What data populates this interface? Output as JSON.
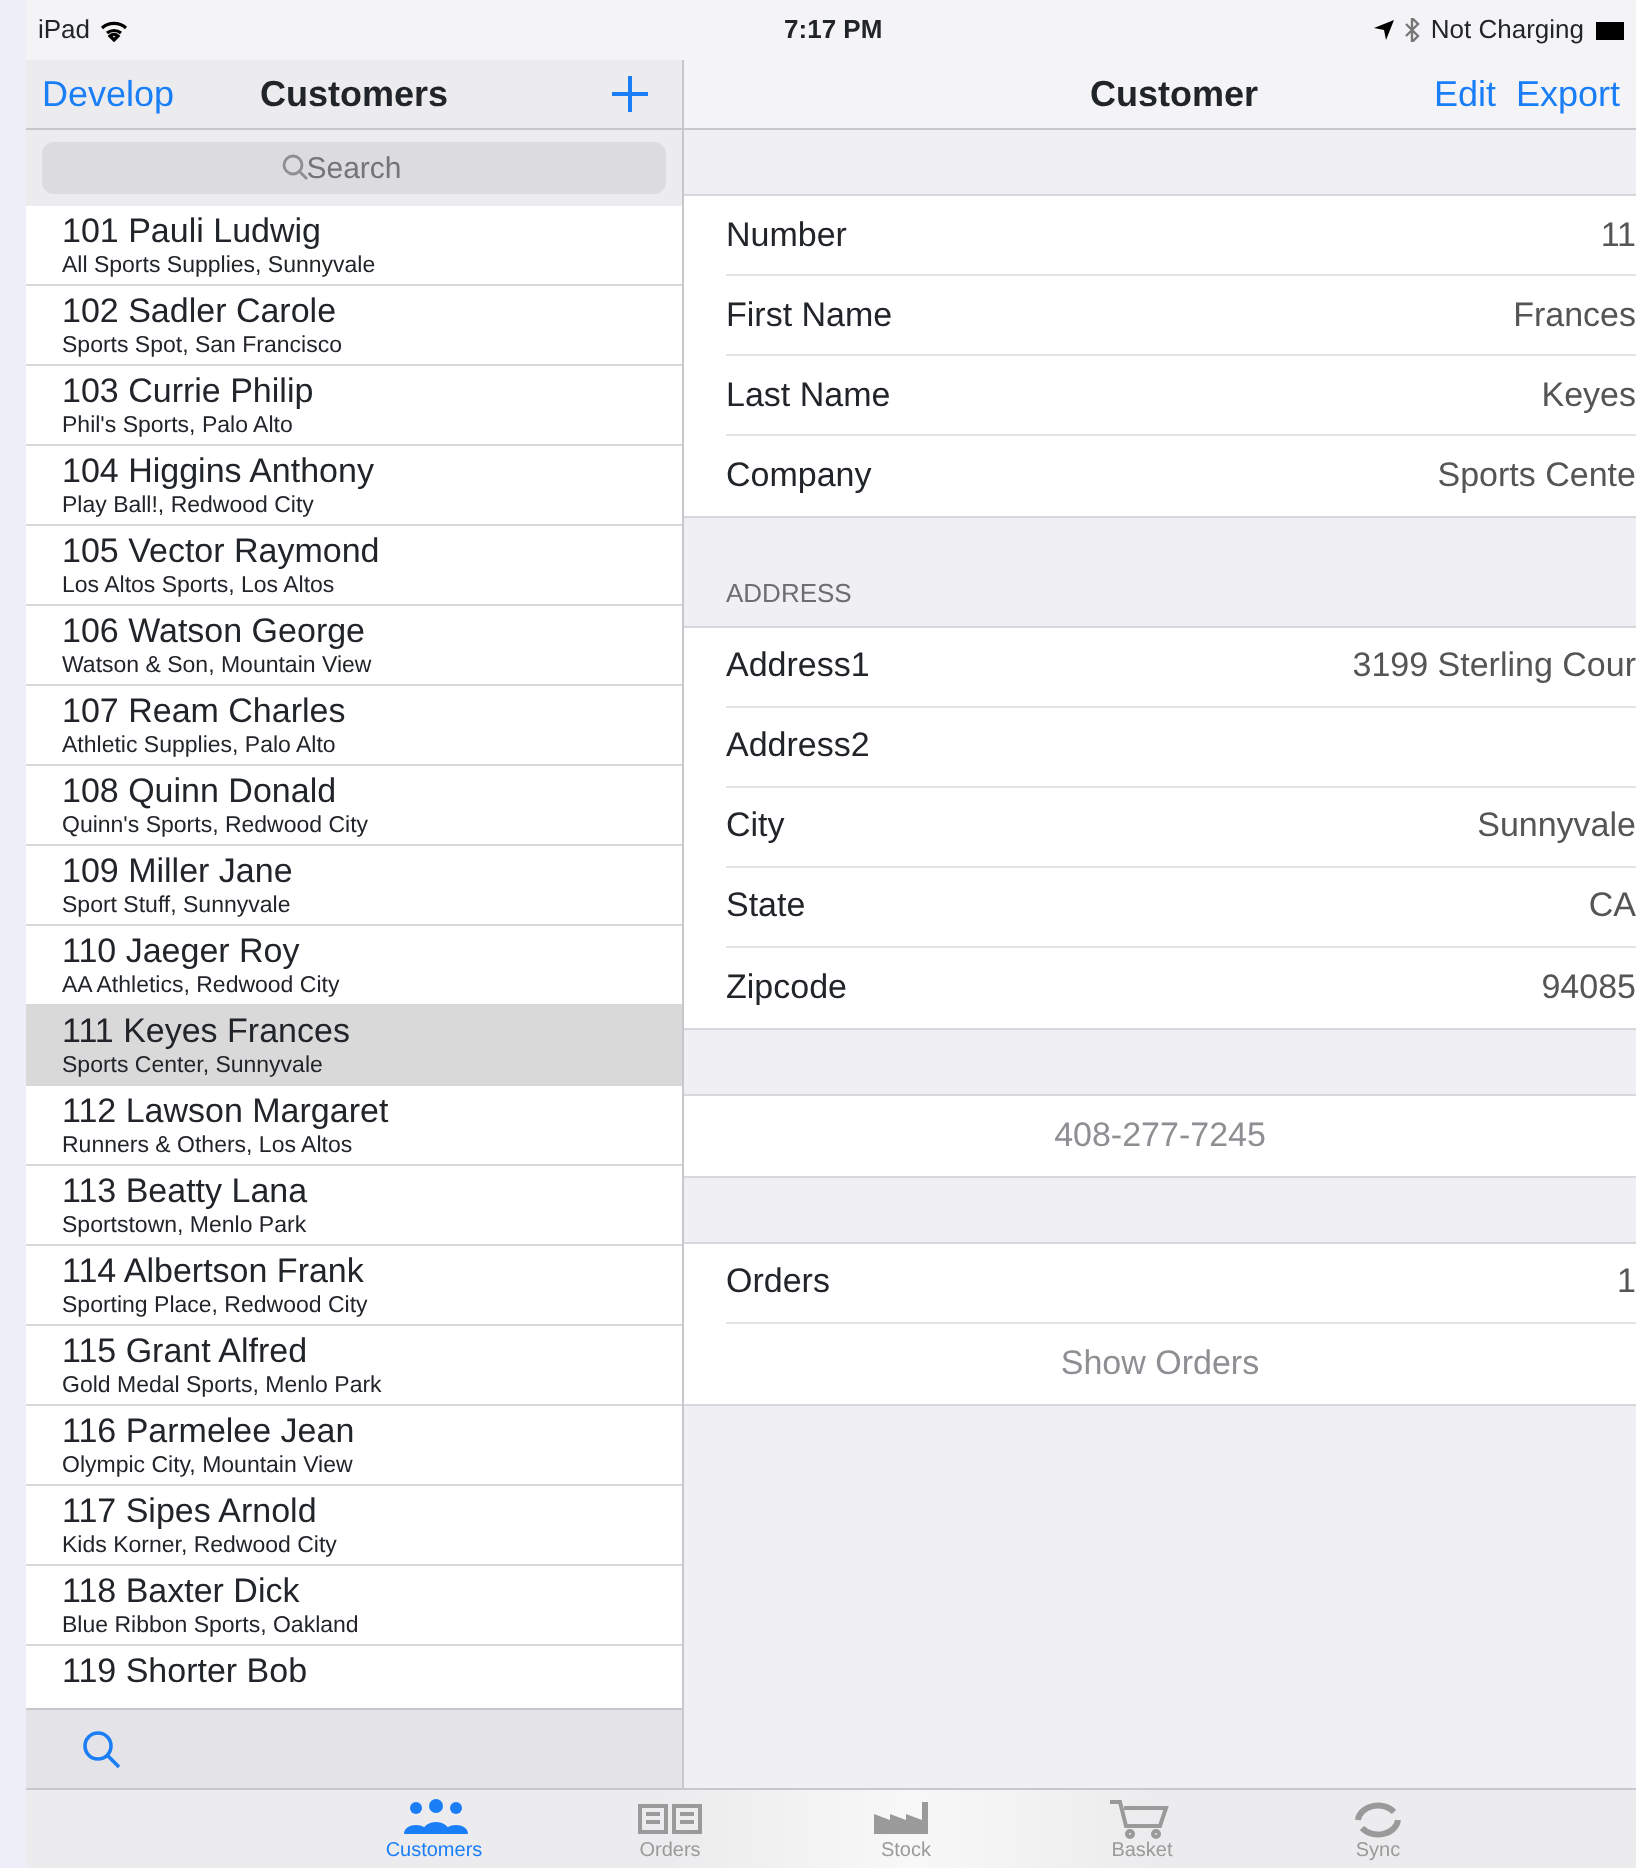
{
  "status_bar": {
    "device": "iPad",
    "time": "7:17 PM",
    "battery_text": "Not Charging"
  },
  "master": {
    "nav": {
      "back": "Develop",
      "title": "Customers"
    },
    "search": {
      "placeholder": "Search"
    },
    "items": [
      {
        "title": "101 Pauli Ludwig",
        "subtitle": "All Sports Supplies, Sunnyvale",
        "selected": false
      },
      {
        "title": "102 Sadler Carole",
        "subtitle": "Sports Spot, San Francisco",
        "selected": false
      },
      {
        "title": "103 Currie Philip",
        "subtitle": "Phil's Sports, Palo Alto",
        "selected": false
      },
      {
        "title": "104 Higgins Anthony",
        "subtitle": "Play Ball!, Redwood City",
        "selected": false
      },
      {
        "title": "105 Vector Raymond",
        "subtitle": "Los Altos Sports, Los Altos",
        "selected": false
      },
      {
        "title": "106 Watson George",
        "subtitle": "Watson & Son, Mountain View",
        "selected": false
      },
      {
        "title": "107 Ream Charles",
        "subtitle": "Athletic Supplies, Palo Alto",
        "selected": false
      },
      {
        "title": "108 Quinn Donald",
        "subtitle": "Quinn's Sports, Redwood City",
        "selected": false
      },
      {
        "title": "109 Miller Jane",
        "subtitle": "Sport Stuff, Sunnyvale",
        "selected": false
      },
      {
        "title": "110 Jaeger Roy",
        "subtitle": "AA Athletics, Redwood City",
        "selected": false
      },
      {
        "title": "111 Keyes Frances",
        "subtitle": "Sports Center, Sunnyvale",
        "selected": true
      },
      {
        "title": "112 Lawson Margaret",
        "subtitle": "Runners & Others, Los Altos",
        "selected": false
      },
      {
        "title": "113 Beatty Lana",
        "subtitle": "Sportstown, Menlo Park",
        "selected": false
      },
      {
        "title": "114 Albertson Frank",
        "subtitle": "Sporting Place, Redwood City",
        "selected": false
      },
      {
        "title": "115 Grant Alfred",
        "subtitle": "Gold Medal Sports, Menlo Park",
        "selected": false
      },
      {
        "title": "116 Parmelee Jean",
        "subtitle": "Olympic City, Mountain View",
        "selected": false
      },
      {
        "title": "117 Sipes Arnold",
        "subtitle": "Kids Korner, Redwood City",
        "selected": false
      },
      {
        "title": "118 Baxter Dick",
        "subtitle": "Blue Ribbon Sports, Oakland",
        "selected": false
      },
      {
        "title": "119 Shorter Bob",
        "selected": false
      }
    ]
  },
  "detail": {
    "nav": {
      "title": "Customer",
      "actions": [
        "Edit",
        "Export"
      ]
    },
    "sections": [
      {
        "rows": [
          {
            "label": "Number",
            "value": "11"
          },
          {
            "label": "First Name",
            "value": "Frances"
          },
          {
            "label": "Last Name",
            "value": "Keyes"
          },
          {
            "label": "Company",
            "value": "Sports Cente"
          }
        ]
      },
      {
        "header": "ADDRESS",
        "rows": [
          {
            "label": "Address1",
            "value": "3199 Sterling Cour"
          },
          {
            "label": "Address2"
          },
          {
            "label": "City",
            "value": "Sunnyvale"
          },
          {
            "label": "State",
            "value": "CA"
          },
          {
            "label": "Zipcode",
            "value": "94085"
          }
        ]
      },
      {
        "rows": [
          {
            "kind": "action",
            "label": "408-277-7245"
          }
        ]
      },
      {
        "rows": [
          {
            "kind": "field",
            "label": "Orders",
            "value": "1"
          },
          {
            "kind": "action",
            "label": "Show Orders"
          }
        ]
      }
    ]
  },
  "tab_bar": [
    {
      "label": "Customers",
      "selected": true
    },
    {
      "label": "Orders",
      "selected": false
    },
    {
      "label": "Stock",
      "selected": false
    },
    {
      "label": "Basket",
      "selected": false
    },
    {
      "label": "Sync",
      "selected": false
    }
  ]
}
